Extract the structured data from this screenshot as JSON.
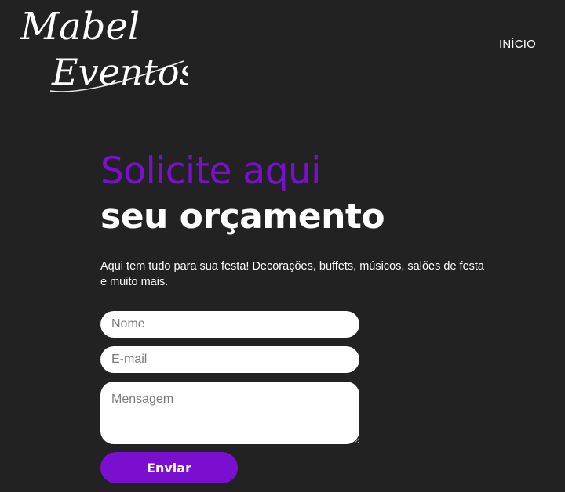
{
  "brand": {
    "line1": "Mabel",
    "line2": "Eventos"
  },
  "nav": {
    "inicio_label": "INÍCIO"
  },
  "hero": {
    "title_line1": "Solicite aqui",
    "title_line2": "seu orçamento",
    "description": "Aqui tem tudo para sua festa! Decorações, buffets, músicos, salões de festa e muito mais."
  },
  "form": {
    "name_placeholder": "Nome",
    "email_placeholder": "E-mail",
    "message_placeholder": "Mensagem",
    "submit_label": "Enviar"
  },
  "colors": {
    "background": "#222222",
    "accent": "#7b0fcf",
    "text": "#ffffff"
  }
}
